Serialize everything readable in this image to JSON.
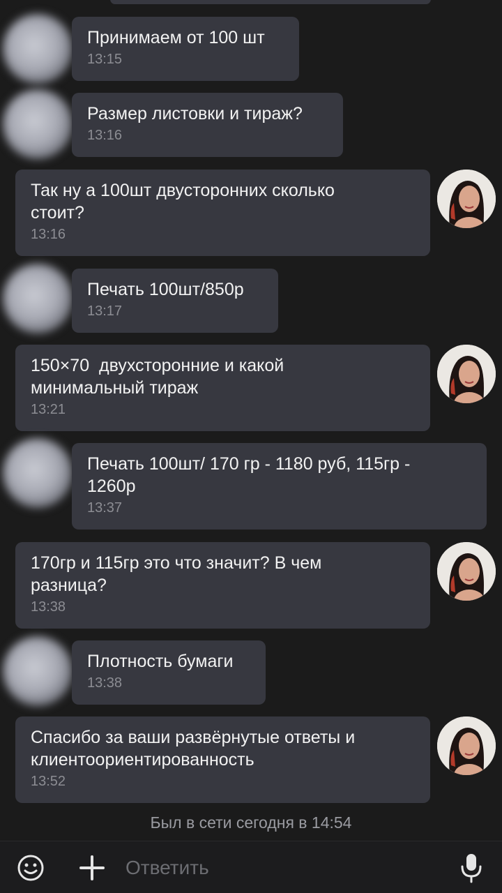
{
  "messages": [
    {
      "side": "in",
      "text": "Принимаем от 100 шт",
      "time": "13:15"
    },
    {
      "side": "in",
      "text": "Размер листовки и тираж?",
      "time": "13:16"
    },
    {
      "side": "out",
      "text": "Так ну а 100шт двусторонних сколько\nстоит?",
      "time": "13:16"
    },
    {
      "side": "in",
      "text": "Печать 100шт/850р",
      "time": "13:17"
    },
    {
      "side": "out",
      "text": "150×70  двухсторонние и какой\nминимальный тираж",
      "time": "13:21"
    },
    {
      "side": "in",
      "text": "Печать 100шт/ 170 гр - 1180 руб, 115гр -\n1260р",
      "time": "13:37"
    },
    {
      "side": "out",
      "text": "170гр и 115гр это что значит? В чем\nразница?",
      "time": "13:38"
    },
    {
      "side": "in",
      "text": "Плотность бумаги",
      "time": "13:38"
    },
    {
      "side": "out",
      "text": "Спасибо за ваши развёрнутые ответы и\nклиентоориентированность",
      "time": "13:52"
    }
  ],
  "status": "Был в сети сегодня в 14:54",
  "input": {
    "placeholder": "Ответить",
    "emoji_icon": "emoji-icon",
    "attach_icon": "plus-icon",
    "mic_icon": "microphone-icon"
  },
  "colors": {
    "background": "#1b1b1b",
    "bubble": "#373840",
    "text": "#f2f2f2",
    "time": "#8c8d93"
  }
}
